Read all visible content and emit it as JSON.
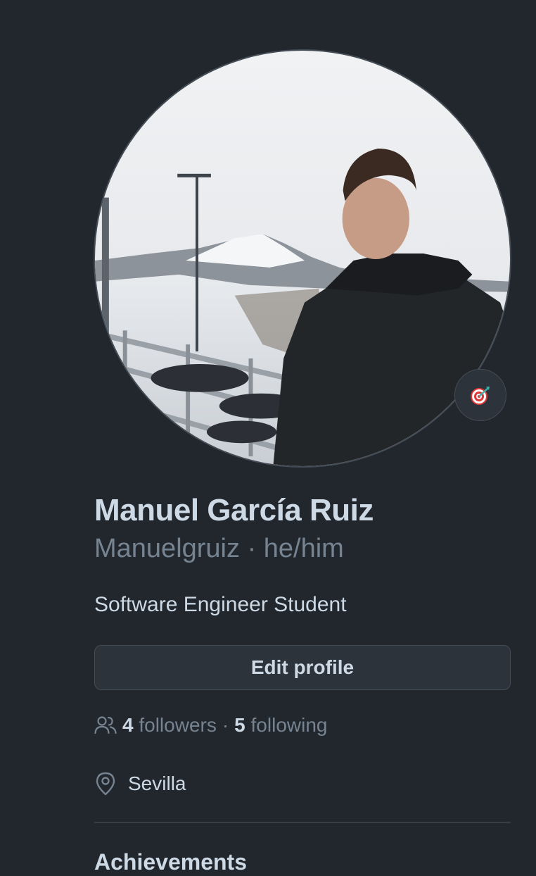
{
  "profile": {
    "full_name": "Manuel García Ruiz",
    "username": "Manuelgruiz",
    "separator": "·",
    "pronouns": "he/him",
    "bio": "Software Engineer Student",
    "avatar_alt": "Profile photo in snowy mountains",
    "status_emoji": "🎯"
  },
  "actions": {
    "edit_profile_label": "Edit profile"
  },
  "stats": {
    "followers_count": "4",
    "followers_label": "followers",
    "dot": "·",
    "following_count": "5",
    "following_label": "following"
  },
  "location": {
    "label": "Sevilla"
  },
  "sections": {
    "achievements_heading": "Achievements"
  },
  "icons": {
    "people": "people-icon",
    "location": "location-icon"
  },
  "colors": {
    "background": "#22272e",
    "text_primary": "#cdd9e5",
    "text_muted": "#768390",
    "border": "#444c56",
    "button_bg": "#2d333b"
  }
}
